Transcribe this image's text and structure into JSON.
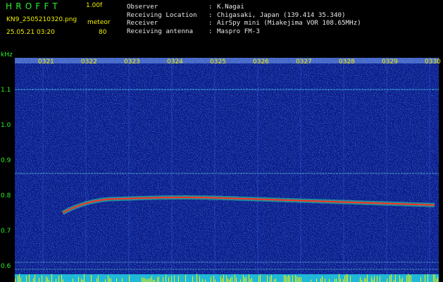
{
  "header": {
    "title": "HROFFT",
    "version": "1.00f",
    "filename": "KN9_2505210320.png",
    "datetime": "25.05.21 03:20",
    "mode_label": "meteor",
    "mode_value": "80"
  },
  "info": [
    {
      "key": "Observer",
      "value": "K.Nagai"
    },
    {
      "key": "Receiving Location",
      "value": "Chigasaki, Japan (139.414 35.340)"
    },
    {
      "key": "Receiver",
      "value": "AirSpy mini (Miakejima VOR 108.65MHz)"
    },
    {
      "key": "Receiving antenna",
      "value": "Maspro FM-3"
    }
  ],
  "axis": {
    "unit": "kHz",
    "y_ticks": [
      "1.1",
      "1.0",
      "0.9",
      "0.8",
      "0.7",
      "0.6"
    ],
    "time_ticks": [
      "0321",
      "0322",
      "0323",
      "0324",
      "0325",
      "0326",
      "0327",
      "0328",
      "0329",
      "0330"
    ]
  },
  "colors": {
    "background": "#000000",
    "spectrogram": "#0a1d8a",
    "header_green": "#2ef02e",
    "header_yellow": "#f0f000",
    "trace_red": "#ff3020"
  }
}
